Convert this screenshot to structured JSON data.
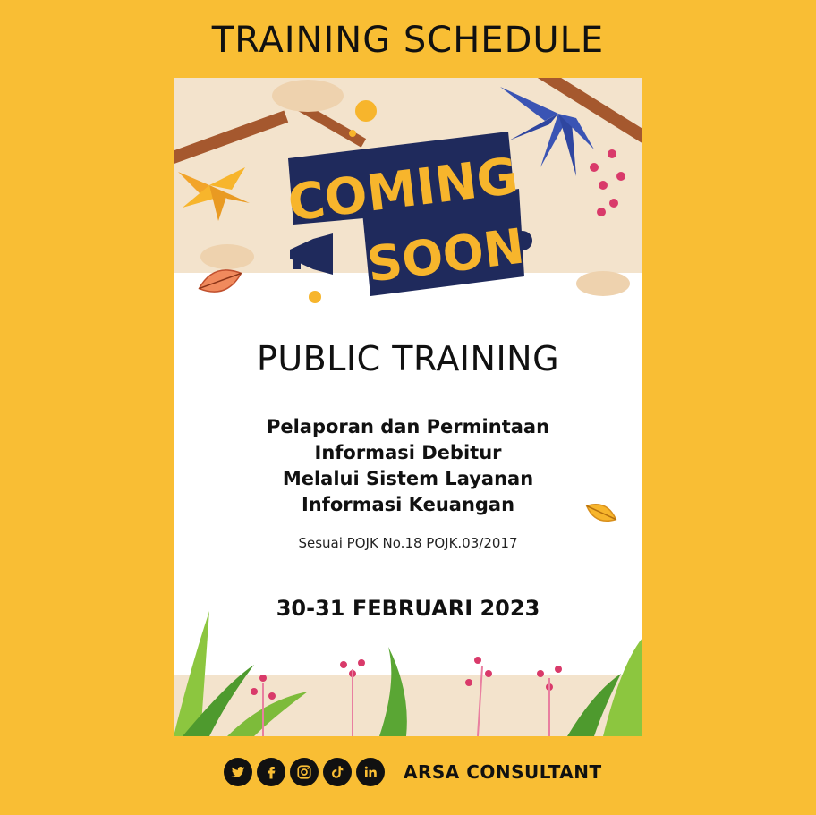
{
  "header": {
    "title": "TRAINING SCHEDULE"
  },
  "poster": {
    "banner_line1": "COMING",
    "banner_line2": "SOON",
    "heading": "PUBLIC TRAINING",
    "subtitle_lines": [
      "Pelaporan dan Permintaan",
      "Informasi Debitur",
      "Melalui Sistem Layanan",
      "Informasi Keuangan"
    ],
    "regulation": "Sesuai POJK No.18 POJK.03/2017",
    "date": "30-31 FEBRUARI 2023"
  },
  "footer": {
    "social_icons": [
      "twitter-icon",
      "facebook-icon",
      "instagram-icon",
      "tiktok-icon",
      "linkedin-icon"
    ],
    "brand": "ARSA CONSULTANT"
  },
  "colors": {
    "background": "#F9BE34",
    "poster_band": "#F3E3CC",
    "banner_navy": "#1F2A5C",
    "banner_yellow": "#F7B52C"
  }
}
